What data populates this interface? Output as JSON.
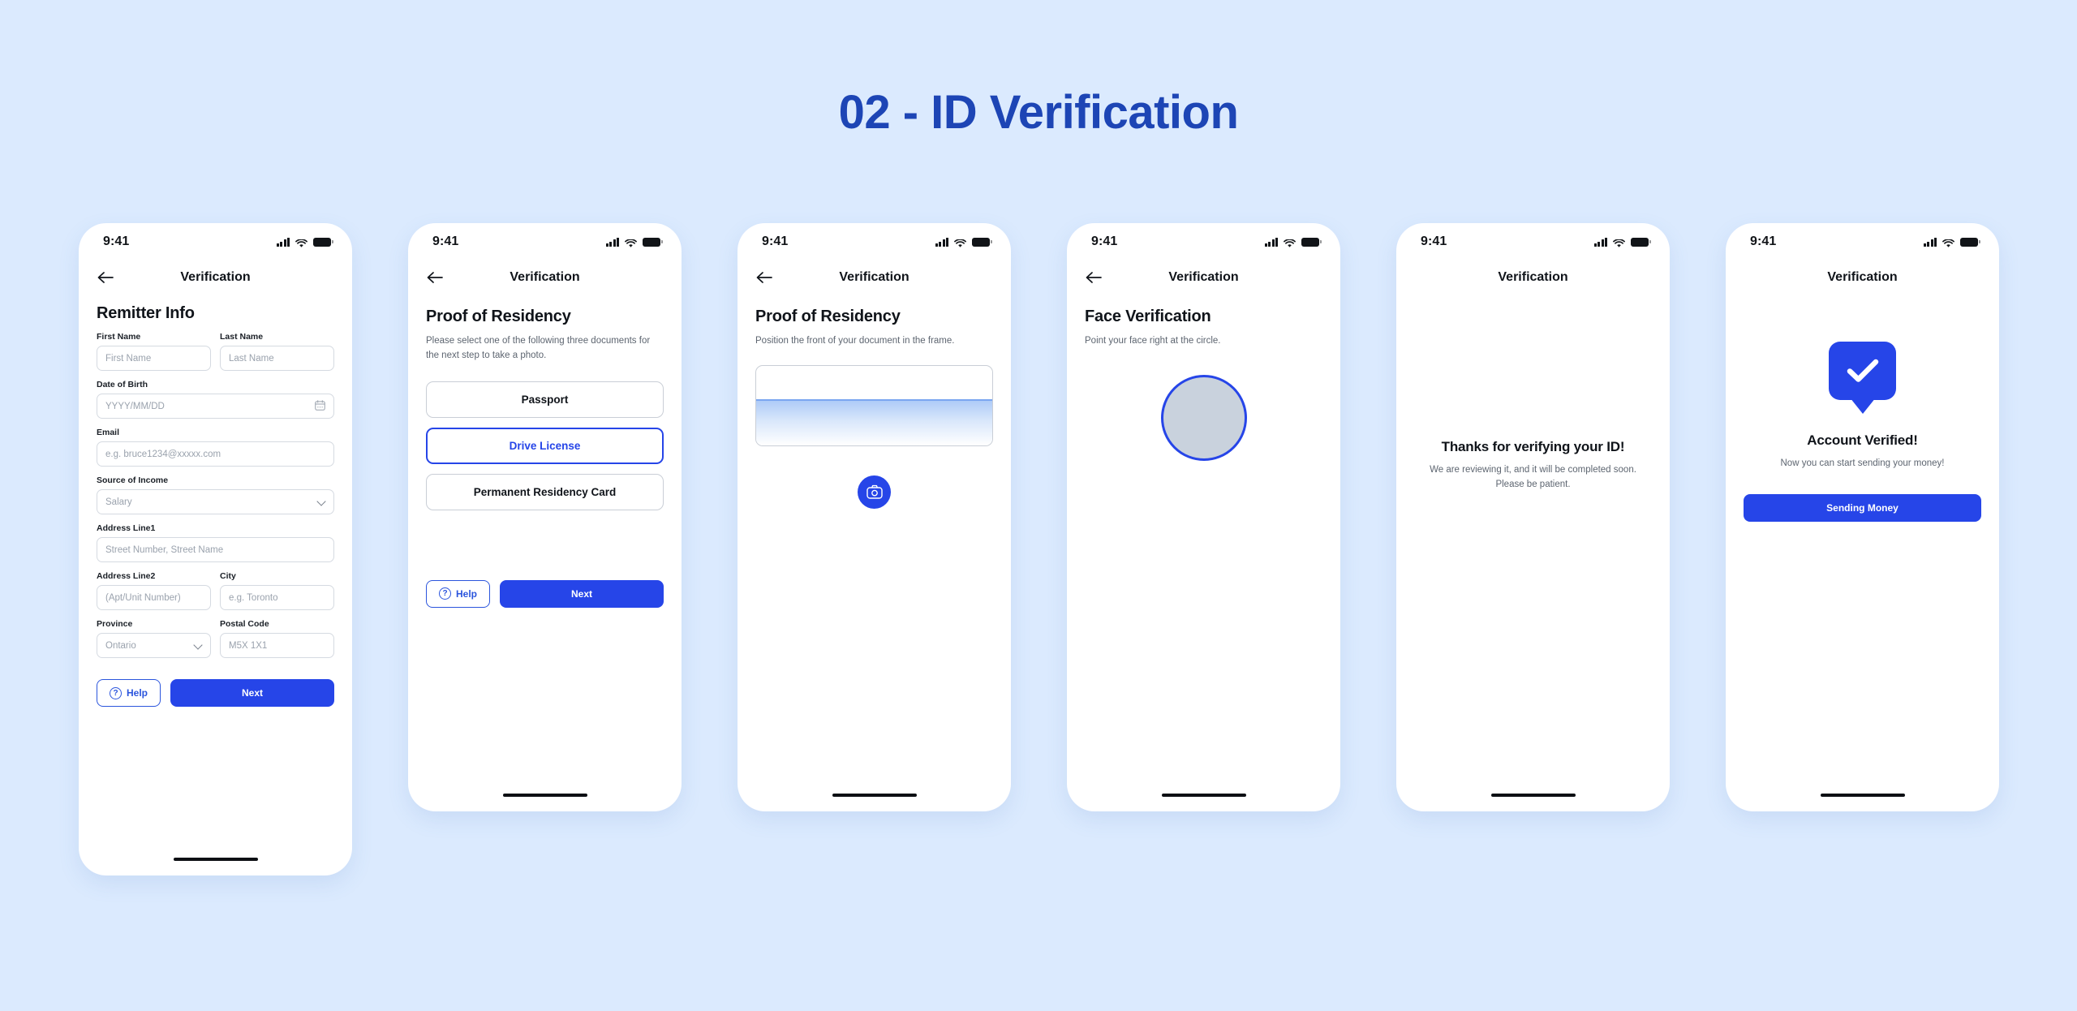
{
  "page": {
    "title": "02 - ID Verification",
    "background_color": "#dbeafe",
    "accent_color": "#2645e8",
    "title_color": "#1d45b5"
  },
  "status_bar": {
    "time": "9:41",
    "icons": [
      "signal-icon",
      "wifi-icon",
      "battery-icon"
    ]
  },
  "screens": [
    {
      "id": "remitter-info",
      "nav_title": "Verification",
      "has_back": true,
      "heading": "Remitter Info",
      "fields": [
        {
          "label": "First Name",
          "placeholder": "First Name",
          "type": "text"
        },
        {
          "label": "Last Name",
          "placeholder": "Last Name",
          "type": "text"
        },
        {
          "label": "Date of Birth",
          "placeholder": "YYYY/MM/DD",
          "type": "date"
        },
        {
          "label": "Email",
          "placeholder": "e.g. bruce1234@xxxxx.com",
          "type": "text"
        },
        {
          "label": "Source of Income",
          "value": "Salary",
          "type": "select"
        },
        {
          "label": "Address Line1",
          "placeholder": "Street Number, Street Name",
          "type": "text"
        },
        {
          "label": "Address Line2",
          "placeholder": "(Apt/Unit Number)",
          "type": "text"
        },
        {
          "label": "City",
          "placeholder": "e.g. Toronto",
          "type": "text"
        },
        {
          "label": "Province",
          "value": "Ontario",
          "type": "select"
        },
        {
          "label": "Postal Code",
          "placeholder": "M5X 1X1",
          "type": "text"
        }
      ],
      "help_label": "Help",
      "next_label": "Next"
    },
    {
      "id": "proof-of-residency-select",
      "nav_title": "Verification",
      "has_back": true,
      "heading": "Proof of Residency",
      "subtext": "Please select one of the following three documents for the next step to take a photo.",
      "options": [
        {
          "label": "Passport",
          "selected": false
        },
        {
          "label": "Drive License",
          "selected": true
        },
        {
          "label": "Permanent Residency Card",
          "selected": false
        }
      ],
      "help_label": "Help",
      "next_label": "Next"
    },
    {
      "id": "proof-of-residency-capture",
      "nav_title": "Verification",
      "has_back": true,
      "heading": "Proof of Residency",
      "subtext": "Position the front of your document in the frame.",
      "shutter_icon": "camera-icon"
    },
    {
      "id": "face-verification",
      "nav_title": "Verification",
      "has_back": true,
      "heading": "Face Verification",
      "subtext": "Point your face right at the circle."
    },
    {
      "id": "verification-pending",
      "nav_title": "Verification",
      "has_back": false,
      "message_title": "Thanks for verifying your ID!",
      "message_body": "We are reviewing it, and it will be completed soon. Please be patient."
    },
    {
      "id": "account-verified",
      "nav_title": "Verification",
      "has_back": false,
      "badge_icon": "check-badge-icon",
      "message_title": "Account Verified!",
      "message_body": "Now you can start sending your money!",
      "cta_label": "Sending Money"
    }
  ]
}
